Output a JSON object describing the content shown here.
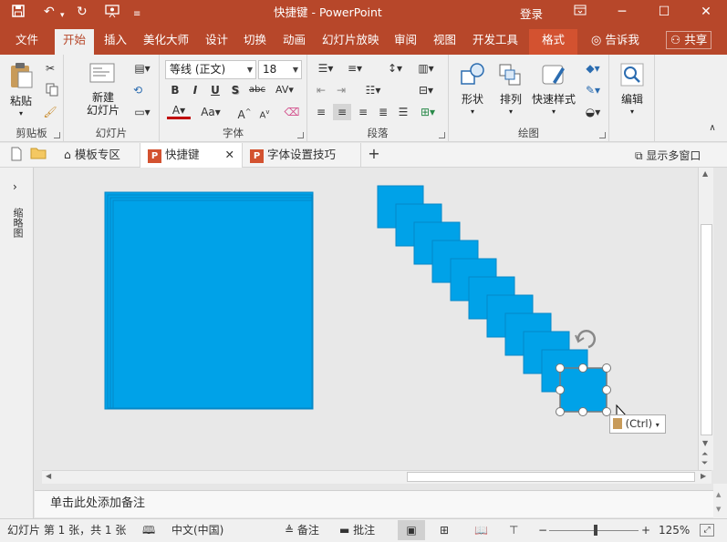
{
  "titlebar": {
    "title": "快捷键 - PowerPoint",
    "login": "登录"
  },
  "tabs": [
    {
      "label": "文件"
    },
    {
      "label": "开始"
    },
    {
      "label": "插入"
    },
    {
      "label": "美化大师"
    },
    {
      "label": "设计"
    },
    {
      "label": "切换"
    },
    {
      "label": "动画"
    },
    {
      "label": "幻灯片放映"
    },
    {
      "label": "审阅"
    },
    {
      "label": "视图"
    },
    {
      "label": "开发工具"
    },
    {
      "label": "格式"
    }
  ],
  "tell_me": "告诉我",
  "share": "共享",
  "ribbon": {
    "clipboard": {
      "paste": "粘贴",
      "group": "剪贴板"
    },
    "slides": {
      "new_slide_line1": "新建",
      "new_slide_line2": "幻灯片",
      "group": "幻灯片"
    },
    "font": {
      "name": "等线 (正文)",
      "size": "18",
      "group": "字体",
      "bold": "B",
      "italic": "I",
      "underline": "U",
      "shadow": "S",
      "strike": "abc",
      "spacing": "AV",
      "color": "A",
      "case": "Aa"
    },
    "paragraph": {
      "group": "段落"
    },
    "drawing": {
      "shapes": "形状",
      "arrange": "排列",
      "quick_styles": "快速样式",
      "group": "绘图"
    },
    "editing": {
      "label": "编辑"
    }
  },
  "doc_tabs": [
    {
      "label": "模板专区"
    },
    {
      "label": "快捷键"
    },
    {
      "label": "字体设置技巧"
    }
  ],
  "show_multi_window": "显示多窗口",
  "left_pane_label": "缩略图",
  "paste_options": "(Ctrl)",
  "notes_placeholder": "单击此处添加备注",
  "status": {
    "slide_info": "幻灯片 第 1 张，共 1 张",
    "language": "中文(中国)",
    "notes": "备注",
    "comments": "批注",
    "zoom": "125%"
  },
  "colors": {
    "brand": "#b7472a",
    "shape_fill": "#00a2e8"
  }
}
